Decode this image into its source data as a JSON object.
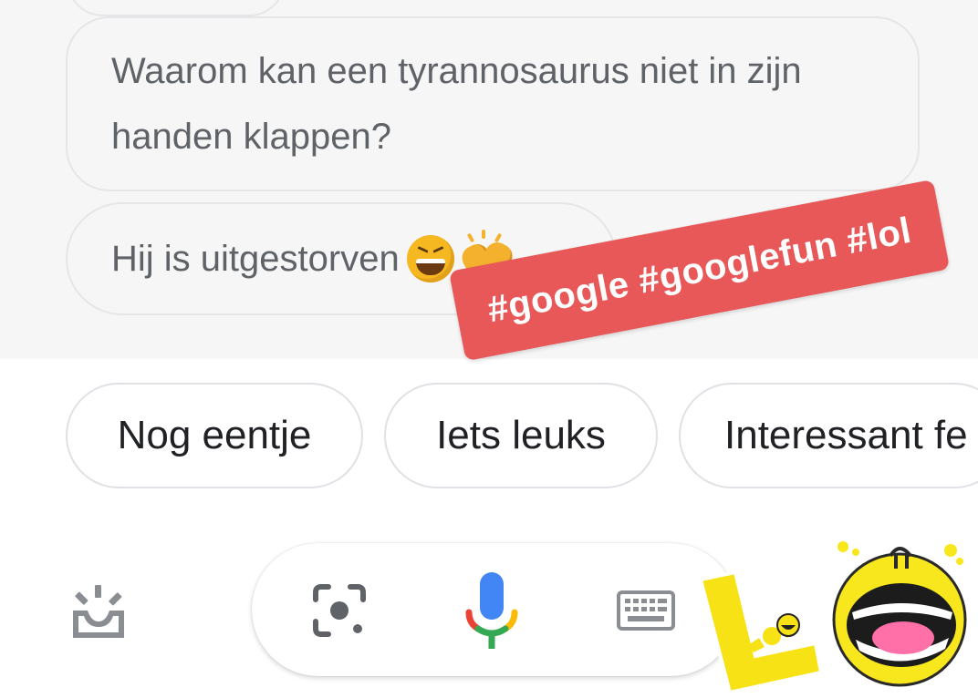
{
  "conversation": {
    "question": "Waarom kan een tyrannosaurus niet in zijn handen klappen?",
    "answer": "Hij is uitgestorven",
    "answer_emojis": [
      "laughing-face-emoji",
      "clapping-hands-emoji"
    ]
  },
  "overlay": {
    "hashtags": "#google #googlefun #lol",
    "banner_color": "#e85858"
  },
  "suggestions": [
    {
      "label": "Nog eentje"
    },
    {
      "label": "Iets leuks"
    },
    {
      "label": "Interessant fe"
    }
  ],
  "bottom_bar": {
    "icons": [
      "snapshot-tray-icon",
      "lens-icon",
      "microphone-icon",
      "keyboard-icon"
    ]
  },
  "sticker": {
    "type": "lol-sticker"
  },
  "colors": {
    "chat_background": "#f6f6f7",
    "mic_blue": "#4285f4",
    "mic_red": "#ea4335",
    "mic_yellow": "#fbbc05",
    "mic_green": "#34a853",
    "icon_gray": "#5f6368"
  }
}
